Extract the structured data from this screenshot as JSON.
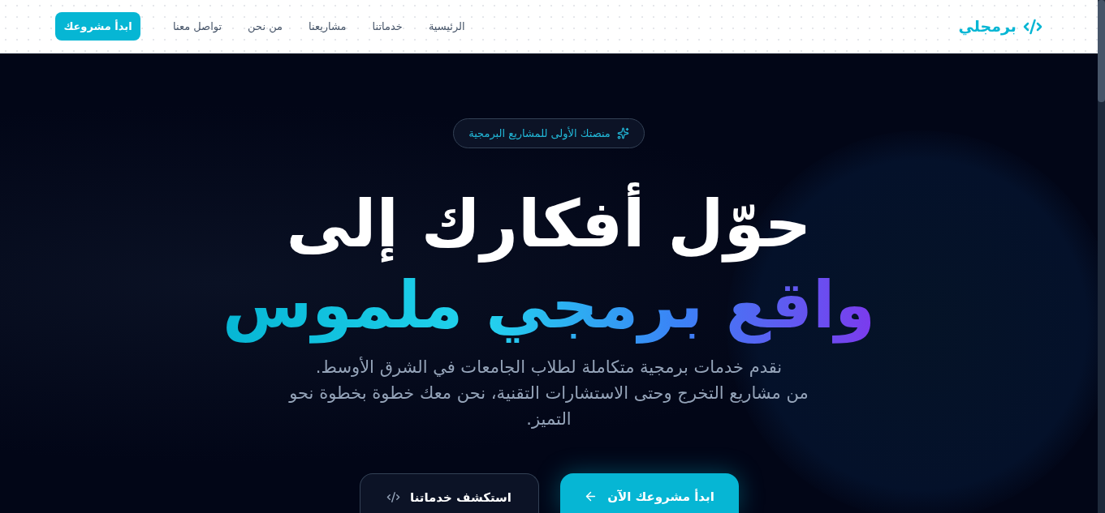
{
  "header": {
    "logo": {
      "text": "برمجلي"
    },
    "nav": [
      {
        "label": "الرئيسية"
      },
      {
        "label": "خدماتنا"
      },
      {
        "label": "مشاريعنا"
      },
      {
        "label": "من نحن"
      },
      {
        "label": "تواصل معنا"
      }
    ],
    "cta": "ابدأ مشروعك"
  },
  "hero": {
    "badge": "منصتك الأولى للمشاريع البرمجية",
    "title_line_1": "حوّل أفكارك إلى",
    "title_line_2": "واقع برمجي ملموس",
    "description": [
      "نقدم خدمات برمجية متكاملة لطلاب الجامعات في الشرق الأوسط.",
      "من مشاريع التخرج وحتى الاستشارات التقنية، نحن معك خطوة بخطوة نحو التميز."
    ],
    "buttons": [
      {
        "label": "ابدأ مشروعك الآن",
        "kind": "primary"
      },
      {
        "label": "استكشف خدماتنا",
        "kind": "secondary"
      }
    ]
  }
}
